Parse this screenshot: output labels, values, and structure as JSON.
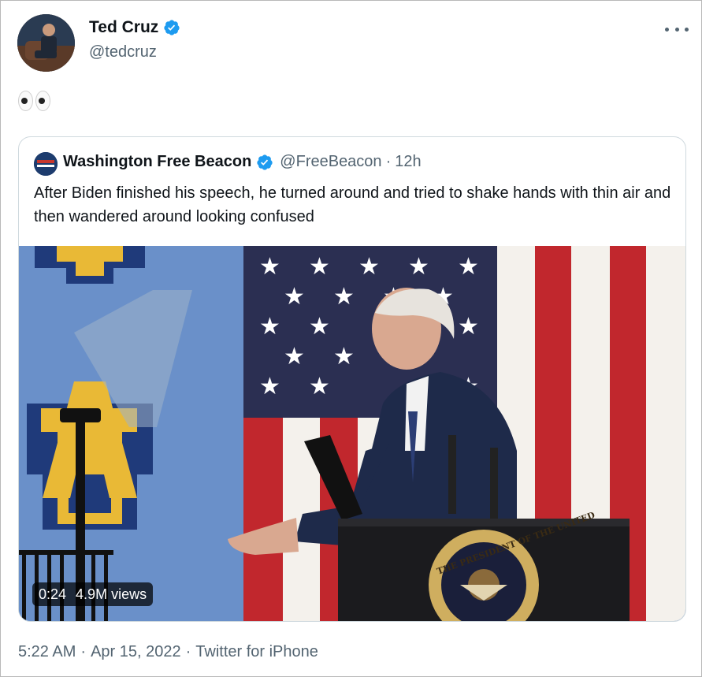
{
  "author": {
    "name": "Ted Cruz",
    "handle": "@tedcruz",
    "verified_icon": "verified-badge-icon",
    "avatar_icon": "avatar"
  },
  "more_icon": "more-options-icon",
  "tweet": {
    "emoji_icon": "eyes-emoji-icon"
  },
  "quoted": {
    "name": "Washington Free Beacon",
    "handle": "@FreeBeacon",
    "separator": "·",
    "time": "12h",
    "text": "After Biden finished his speech, he turned around and tried to shake hands with thin air and then wandered around looking confused",
    "video": {
      "duration": "0:24",
      "views": "4.9M views",
      "seal_text": "THE PRESIDENT OF THE UNITED"
    }
  },
  "footer": {
    "time": "5:22 AM",
    "sep1": "·",
    "date": "Apr 15, 2022",
    "sep2": "·",
    "source": "Twitter for iPhone"
  },
  "colors": {
    "verified": "#1d9bf0",
    "muted": "#536471",
    "text": "#0f1419"
  }
}
